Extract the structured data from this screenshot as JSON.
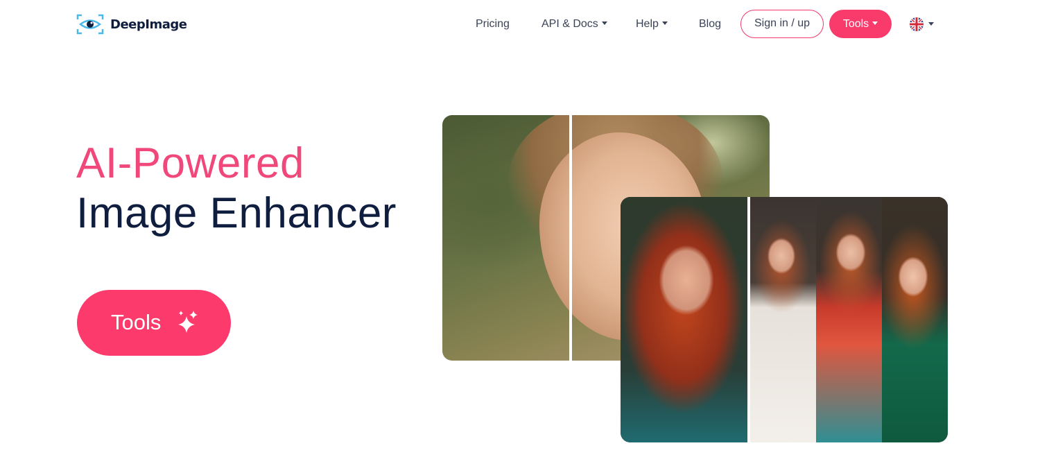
{
  "brand": {
    "name": "DeepImage",
    "accent_color": "#f93b6c",
    "text_color": "#0f1d3f"
  },
  "nav": {
    "pricing": "Pricing",
    "api_docs": "API & Docs",
    "help": "Help",
    "blog": "Blog",
    "sign_in": "Sign in / up",
    "tools": "Tools",
    "language_icon": "uk-flag-icon"
  },
  "hero": {
    "title_line1": "AI-Powered",
    "title_line2": "Image Enhancer",
    "tools_button": "Tools",
    "tools_button_icon": "sparkle-icon"
  },
  "images": {
    "back_image": "before-after-portrait",
    "front_image": "before-after-redhead-portraits"
  }
}
